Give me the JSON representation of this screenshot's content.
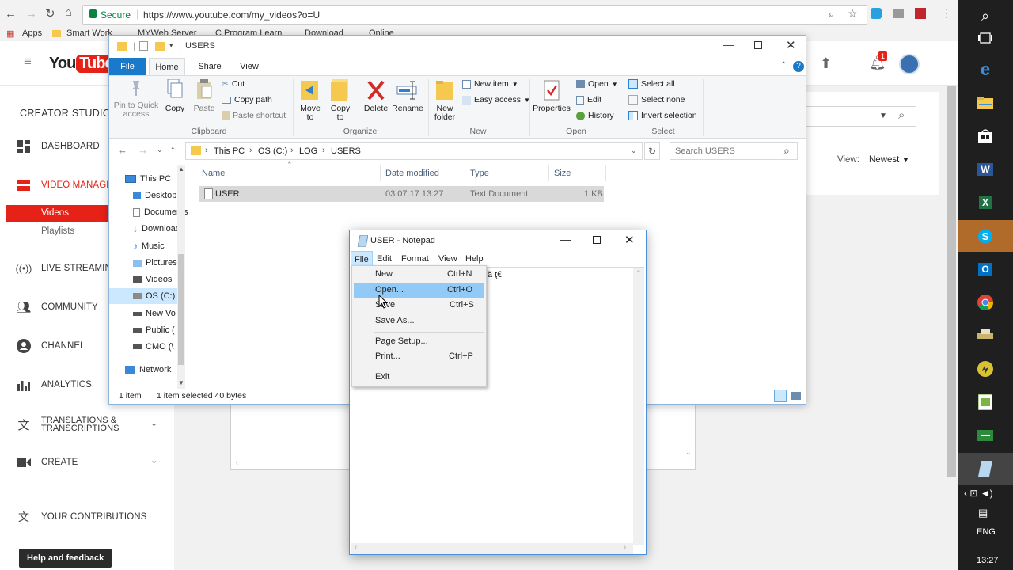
{
  "browser": {
    "secure_label": "Secure",
    "url": "https://www.youtube.com/my_videos?o=U",
    "bookmarks": [
      "Apps",
      "Smart Work",
      "MYWeb Server",
      "C Program Learn",
      "Download",
      "Online"
    ]
  },
  "youtube": {
    "logo": "You Tube",
    "notification_count": "1",
    "creator_studio": "CREATOR STUDIO",
    "sidebar": {
      "dashboard": "DASHBOARD",
      "video_manager": "VIDEO MANAGER",
      "videos": "Videos",
      "playlists": "Playlists",
      "live_streaming": "LIVE STREAMING",
      "community": "COMMUNITY",
      "channel": "CHANNEL",
      "analytics": "ANALYTICS",
      "translations": "TRANSLATIONS &",
      "transcriptions": "TRANSCRIPTIONS",
      "create": "CREATE",
      "your_contributions": "YOUR CONTRIBUTIONS",
      "help_feedback": "Help and feedback"
    },
    "view_label": "View:",
    "view_value": "Newest"
  },
  "explorer": {
    "title": "USERS",
    "tabs": [
      "File",
      "Home",
      "Share",
      "View"
    ],
    "ribbon": {
      "pin": "Pin to Quick access",
      "copy": "Copy",
      "paste": "Paste",
      "cut": "Cut",
      "copy_path": "Copy path",
      "paste_shortcut": "Paste shortcut",
      "clipboard": "Clipboard",
      "move_to": "Move to",
      "copy_to": "Copy to",
      "delete": "Delete",
      "rename": "Rename",
      "organize": "Organize",
      "new_folder": "New folder",
      "new_item": "New item",
      "easy_access": "Easy access",
      "new": "New",
      "properties": "Properties",
      "open": "Open",
      "edit": "Edit",
      "history": "History",
      "open_group": "Open",
      "select_all": "Select all",
      "select_none": "Select none",
      "invert_selection": "Invert selection",
      "select": "Select"
    },
    "breadcrumb": [
      "This PC",
      "OS (C:)",
      "LOG",
      "USERS"
    ],
    "search_placeholder": "Search USERS",
    "nav": [
      "This PC",
      "Desktop",
      "Documents",
      "Downloads",
      "Music",
      "Pictures",
      "Videos",
      "OS (C:)",
      "New Vo",
      "Public (",
      "CMO (\\",
      "Network"
    ],
    "columns": [
      "Name",
      "Date modified",
      "Type",
      "Size"
    ],
    "files": [
      {
        "name": "USER",
        "date": "03.07.17 13:27",
        "type": "Text Document",
        "size": "1 KB"
      }
    ],
    "status": {
      "count": "1 item",
      "selected": "1 item selected  40 bytes"
    }
  },
  "notepad": {
    "title": "USER - Notepad",
    "menu": [
      "File",
      "Edit",
      "Format",
      "View",
      "Help"
    ],
    "content_glyphs": "ä  ţ€",
    "file_menu": [
      {
        "label": "New",
        "shortcut": "Ctrl+N"
      },
      {
        "label": "Open...",
        "shortcut": "Ctrl+O"
      },
      {
        "label": "Save",
        "shortcut": "Ctrl+S"
      },
      {
        "label": "Save As...",
        "shortcut": ""
      },
      {
        "label": "Page Setup...",
        "shortcut": ""
      },
      {
        "label": "Print...",
        "shortcut": "Ctrl+P"
      },
      {
        "label": "Exit",
        "shortcut": ""
      }
    ]
  },
  "system": {
    "language": "ENG",
    "time": "13:27"
  },
  "colors": {
    "youtube_red": "#e62117",
    "explorer_file_tab": "#1979ca",
    "menu_highlight": "#91c9f7",
    "selection": "#cce8ff"
  }
}
